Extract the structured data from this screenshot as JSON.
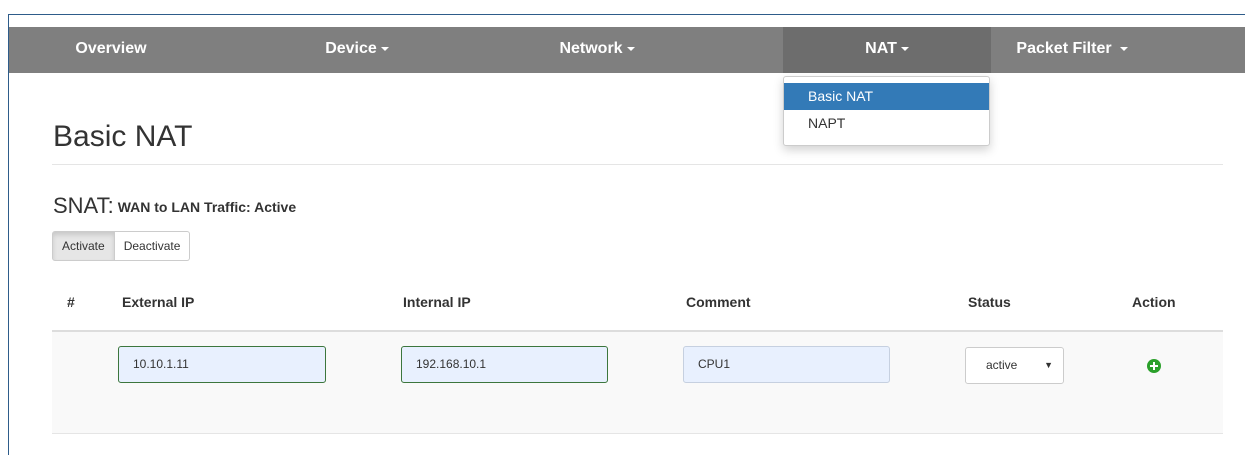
{
  "nav": {
    "items": [
      {
        "label": "Overview"
      },
      {
        "label": "Device"
      },
      {
        "label": "Network"
      },
      {
        "label": "NAT"
      },
      {
        "label": "Packet Filter"
      }
    ],
    "active": "NAT",
    "bar_color": "#7f7f7f"
  },
  "dropdown": {
    "items": [
      {
        "label": "Basic NAT",
        "selected": true
      },
      {
        "label": "NAPT",
        "selected": false
      }
    ],
    "highlight_color": "#337ab7"
  },
  "page": {
    "title": "Basic NAT"
  },
  "snat": {
    "title": "SNAT:",
    "status_text": "WAN to LAN Traffic: Active",
    "activate_label": "Activate",
    "deactivate_label": "Deactivate"
  },
  "table": {
    "headers": {
      "num": "#",
      "external_ip": "External IP",
      "internal_ip": "Internal IP",
      "comment": "Comment",
      "status": "Status",
      "action": "Action"
    },
    "rows": [
      {
        "num": "",
        "external_ip": "10.10.1.11",
        "internal_ip": "192.168.10.1",
        "comment": "CPU1",
        "status": "active",
        "action_icon": "add-circle-icon"
      }
    ]
  },
  "colors": {
    "add_icon": "#2ba02b",
    "valid_border": "#3c763d"
  }
}
